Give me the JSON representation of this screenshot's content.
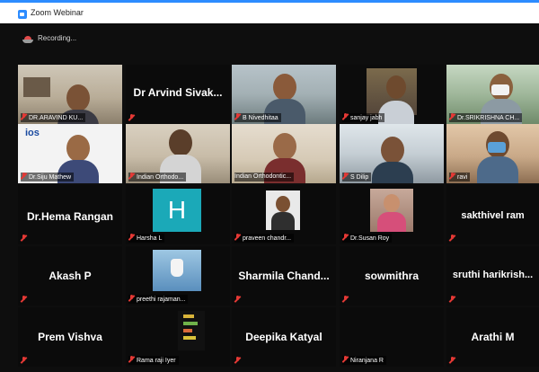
{
  "window": {
    "title": "Zoom Webinar"
  },
  "recording": {
    "label": "Recording..."
  },
  "participants": [
    {
      "name": "DR.ARAVIND KU..."
    },
    {
      "name": "Dr Arvind Sivak..."
    },
    {
      "name": "B Nivedhitaa"
    },
    {
      "name": "sanjay jabh"
    },
    {
      "name": "Dr.SRIKRISHNA CH..."
    },
    {
      "name": "Dr.Siju Mathew"
    },
    {
      "name": "Indian Orthodo..."
    },
    {
      "name": "Indian Orthodontic..."
    },
    {
      "name": "S Dilip"
    },
    {
      "name": "ravi"
    },
    {
      "name": "Dr.Hema Rangan"
    },
    {
      "name": "Harsha L",
      "initial": "H"
    },
    {
      "name": "praveen chandr..."
    },
    {
      "name": "Dr.Susan Roy"
    },
    {
      "name": "sakthivel ram"
    },
    {
      "name": "Akash P"
    },
    {
      "name": "preethi rajaman..."
    },
    {
      "name": "Sharmila Chand..."
    },
    {
      "name": "sowmithra"
    },
    {
      "name": "sruthi harikrish..."
    },
    {
      "name": "Prem Vishva"
    },
    {
      "name": "Rama raji Iyer"
    },
    {
      "name": "Deepika Katyal"
    },
    {
      "name": "Niranjana R"
    },
    {
      "name": "Arathi M"
    }
  ],
  "logo_text": "ios",
  "colors": {
    "accent": "#2d8cff",
    "muted_mic": "#e53935",
    "active_speaker": "#bfe03a",
    "tile_teal": "#1ba9b8"
  }
}
